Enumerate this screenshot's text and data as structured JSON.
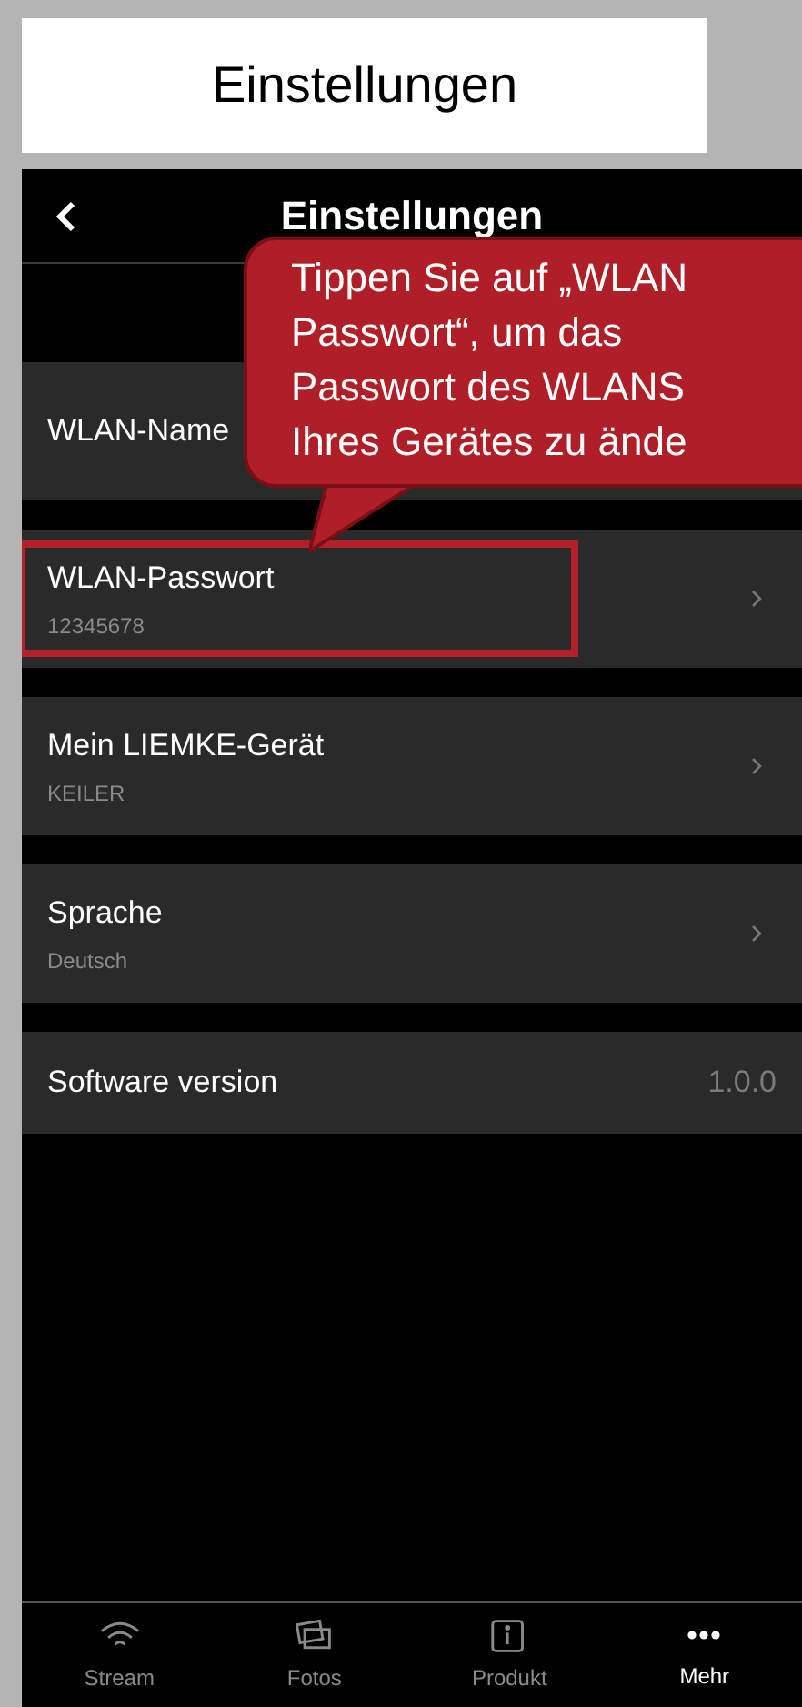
{
  "caption": {
    "title": "Einstellungen"
  },
  "header": {
    "title": "Einstellungen"
  },
  "rows": [
    {
      "kind": "nav",
      "label": "WLAN-Name",
      "highlighted": false
    },
    {
      "kind": "nav",
      "label": "WLAN-Passwort",
      "value": "12345678",
      "highlighted": true
    },
    {
      "kind": "nav",
      "label": "Mein LIEMKE-Gerät",
      "value": "KEILER",
      "highlighted": false
    },
    {
      "kind": "nav",
      "label": "Sprache",
      "value": "Deutsch",
      "highlighted": false
    },
    {
      "kind": "info",
      "label": "Software version",
      "value": "1.0.0",
      "highlighted": false
    }
  ],
  "callout": {
    "lines": [
      "Tippen Sie auf „WLAN",
      "Passwort“, um das",
      "Passwort des WLANS",
      "Ihres Gerätes zu ände"
    ]
  },
  "tabs": [
    {
      "label": "Stream",
      "kind": "wifi",
      "selected": false
    },
    {
      "label": "Fotos",
      "kind": "photos",
      "selected": false
    },
    {
      "label": "Produkt",
      "kind": "info",
      "selected": false
    },
    {
      "label": "Mehr",
      "kind": "more",
      "selected": true
    }
  ]
}
